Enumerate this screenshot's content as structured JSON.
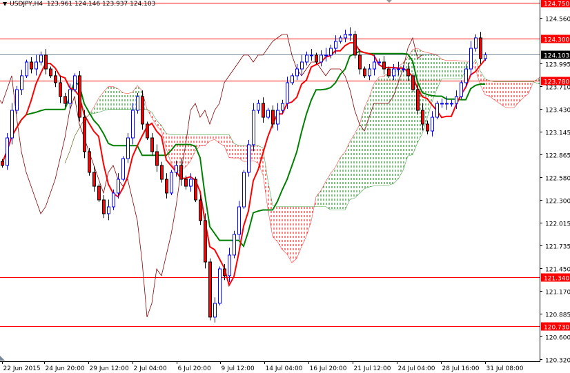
{
  "header": {
    "symbol": "USDJPY,H4",
    "open": "123.961",
    "high": "124.146",
    "low": "123.937",
    "close": "124.103"
  },
  "colors": {
    "bull": "#0000ff",
    "bear": "#000000",
    "bear_fill": "#ff0000",
    "tenkan": "#ff0000",
    "kijun": "#008000",
    "chikou": "#8b0000",
    "cloud_up": "#008000",
    "cloud_down": "#ff0000",
    "level_line": "#ff0000",
    "price_line": "#778899"
  },
  "chart_data": {
    "type": "candlestick",
    "title": "USDJPY,H4",
    "indicator": "Ichimoku Kinko Hyo",
    "ylim": [
      120.32,
      124.75
    ],
    "y_ticks": [
      "124.560",
      "123.995",
      "123.710",
      "123.430",
      "123.145",
      "122.865",
      "122.580",
      "122.300",
      "122.015",
      "121.735",
      "121.450",
      "121.170",
      "120.885",
      "120.600",
      "120.320"
    ],
    "x_ticks": [
      {
        "label": "22 Jun 2015",
        "bar": 0
      },
      {
        "label": "24 Jun 20:00",
        "bar": 8.7
      },
      {
        "label": "29 Jun 12:00",
        "bar": 17.9
      },
      {
        "label": "2 Jul 04:00",
        "bar": 27
      },
      {
        "label": "6 Jul 20:00",
        "bar": 36.1
      },
      {
        "label": "9 Jul 12:00",
        "bar": 45.1
      },
      {
        "label": "14 Jul 04:00",
        "bar": 54.3
      },
      {
        "label": "16 Jul 20:00",
        "bar": 63.4
      },
      {
        "label": "21 Jul 12:00",
        "bar": 72.6
      },
      {
        "label": "24 Jul 04:00",
        "bar": 81.7
      },
      {
        "label": "28 Jul 16:00",
        "bar": 90.9
      },
      {
        "label": "31 Jul 08:00",
        "bar": 100
      }
    ],
    "levels": [
      {
        "label": "124.750",
        "value": 124.75
      },
      {
        "label": "124.300",
        "value": 124.3
      },
      {
        "label": "123.780",
        "value": 123.78
      },
      {
        "label": "121.340",
        "value": 121.34
      },
      {
        "label": "120.730",
        "value": 120.73
      }
    ],
    "current_price": {
      "label": "124.103",
      "value": 124.103
    },
    "closes": [
      122.728,
      123.07,
      123.413,
      123.67,
      123.842,
      124.013,
      123.927,
      124.013,
      124.099,
      123.927,
      123.842,
      123.756,
      123.584,
      123.499,
      123.67,
      123.842,
      123.327,
      122.899,
      122.642,
      122.47,
      122.299,
      122.128,
      122.213,
      122.385,
      122.556,
      122.813,
      123.07,
      123.413,
      123.584,
      123.242,
      123.07,
      122.899,
      122.728,
      122.556,
      122.385,
      122.642,
      122.728,
      122.556,
      122.47,
      122.556,
      122.299,
      122.042,
      121.528,
      120.843,
      121.014,
      121.442,
      121.357,
      121.614,
      121.871,
      122.213,
      122.642,
      122.985,
      123.413,
      123.499,
      123.327,
      123.413,
      123.242,
      123.413,
      123.499,
      123.756,
      123.842,
      123.927,
      124.013,
      124.099,
      124.099,
      124.013,
      124.099,
      124.099,
      124.184,
      124.27,
      124.313,
      124.356,
      124.356,
      124.099,
      123.927,
      123.842,
      123.927,
      124.013,
      124.013,
      123.927,
      123.842,
      123.927,
      123.927,
      123.927,
      123.842,
      123.67,
      123.413,
      123.242,
      123.156,
      123.327,
      123.499,
      123.499,
      123.499,
      123.499,
      123.584,
      123.756,
      123.927,
      124.184,
      124.313,
      124.056,
      124.103
    ]
  }
}
